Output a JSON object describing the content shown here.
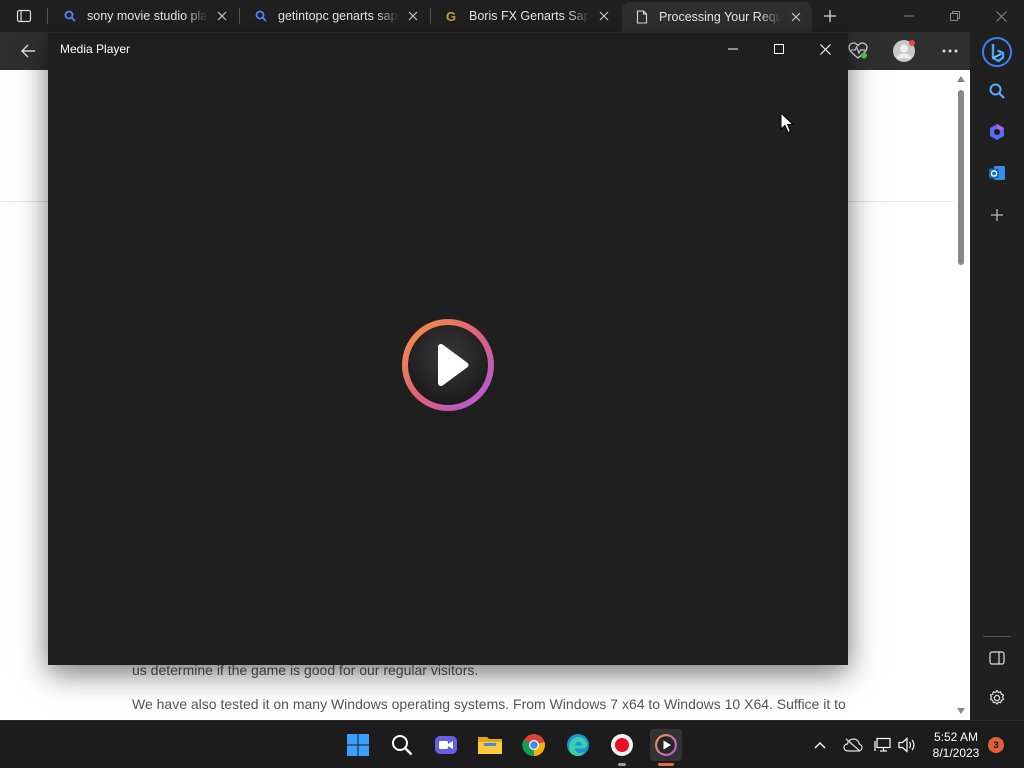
{
  "browser": {
    "tabs": [
      {
        "title": "sony movie studio platinum",
        "favicon": "search-icon"
      },
      {
        "title": "getintopc genarts sapphire",
        "favicon": "search-icon"
      },
      {
        "title": "Boris FX Genarts Sapphire",
        "favicon": "g-site-icon"
      },
      {
        "title": "Processing Your Request",
        "favicon": "document-icon"
      }
    ],
    "active_tab_index": 3
  },
  "page": {
    "visible_text": [
      "us determine if the game is good for our regular visitors.",
      "We have also tested it on many Windows operating systems. From Windows 7 x64 to Windows 10 X64. Suffice it to"
    ]
  },
  "media_player": {
    "title": "Media Player",
    "play_icon": "play-icon"
  },
  "taskbar": {
    "apps": [
      "start-icon",
      "search-icon",
      "teams-chat-icon",
      "file-explorer-icon",
      "chrome-icon",
      "edge-icon",
      "record-icon",
      "media-player-icon"
    ],
    "time": "5:52 AM",
    "date": "8/1/2023",
    "notification_count": "3"
  },
  "colors": {
    "accent_orange": "#f0883a",
    "accent_purple": "#b05ae0",
    "edge_blue": "#1f6feb"
  }
}
